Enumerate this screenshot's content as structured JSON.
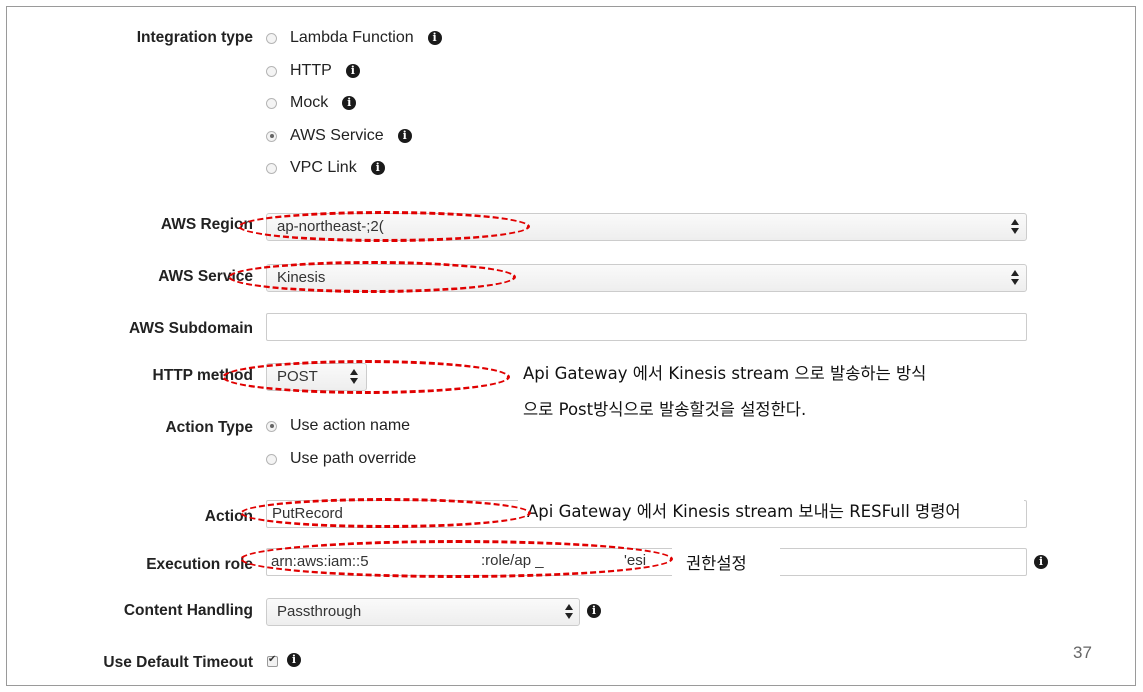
{
  "integration": {
    "label": "Integration type",
    "options": [
      {
        "label": "Lambda Function",
        "checked": false
      },
      {
        "label": "HTTP",
        "checked": false
      },
      {
        "label": "Mock",
        "checked": false
      },
      {
        "label": "AWS Service",
        "checked": true
      },
      {
        "label": "VPC Link",
        "checked": false
      }
    ]
  },
  "region": {
    "label": "AWS Region",
    "value": "ap-northeast-;2("
  },
  "service": {
    "label": "AWS Service",
    "value": "Kinesis"
  },
  "subdomain": {
    "label": "AWS Subdomain",
    "value": ""
  },
  "http_method": {
    "label": "HTTP method",
    "value": "POST"
  },
  "action_type": {
    "label": "Action Type",
    "options": [
      {
        "label": "Use action name",
        "checked": true
      },
      {
        "label": "Use path override",
        "checked": false
      }
    ]
  },
  "action": {
    "label": "Action",
    "value": "PutRecord"
  },
  "execution_role": {
    "label": "Execution role",
    "value_start": "arn:aws:iam::5",
    "value_mid": ":role/ap _",
    "value_end": "'esi"
  },
  "content_handling": {
    "label": "Content Handling",
    "value": "Passthrough"
  },
  "default_timeout": {
    "label": "Use Default Timeout",
    "checked": true
  },
  "annotations": {
    "method_line1": "Api Gateway 에서 Kinesis stream 으로 발송하는 방식",
    "method_line2": "으로 Post방식으로 발송할것을 설정한다.",
    "action_note": "Api Gateway 에서 Kinesis stream 보내는 RESFull 명령어",
    "role_note": "권한설정"
  },
  "page_number": "37",
  "colors": {
    "annotation_ellipse": "#e00000",
    "info_icon": "#1a1a1a"
  },
  "icons": {
    "info": "info-circle-icon",
    "select_arrows": "updown-arrows-icon",
    "check": "checkmark-icon"
  }
}
